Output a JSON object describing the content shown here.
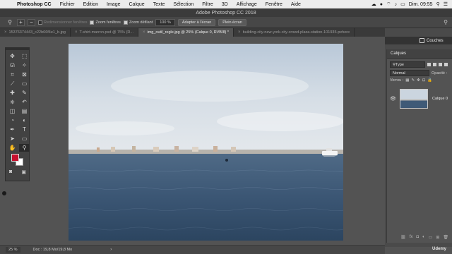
{
  "menubar": {
    "app_name": "Photoshop CC",
    "items": [
      "Fichier",
      "Edition",
      "Image",
      "Calque",
      "Texte",
      "Sélection",
      "Filtre",
      "3D",
      "Affichage",
      "Fenêtre",
      "Aide"
    ],
    "clock": "Dim. 09:55"
  },
  "titlebar": {
    "title": "Adobe Photoshop CC 2018"
  },
  "optionsbar": {
    "redimensionner_label": "Redimensionner fenêtres",
    "zoom_fenetres_label": "Zoom fenêtres",
    "zoom_defilant_label": "Zoom défilant",
    "zoom_value": "100 %",
    "fit_button": "Adapter à l'écran",
    "fill_button": "Plein écran"
  },
  "tabs": [
    {
      "label": "15376374443_c22b66f4e1_b.jpg",
      "active": false
    },
    {
      "label": "T-shirt-marron.psd @ 75% (R...",
      "active": false
    },
    {
      "label": "img_outil_regle.jpg @ 25% (Calque 0, RVB/8) *",
      "active": true
    },
    {
      "label": "building-city-new-york-city-crowd-plaza-station-101935-pxhere",
      "active": false
    }
  ],
  "tools": {
    "icons": [
      "move-icon",
      "marquee-icon",
      "lasso-icon",
      "magic-wand-icon",
      "crop-icon",
      "frame-icon",
      "eyedropper-icon",
      "ruler-icon",
      "healing-icon",
      "brush-icon",
      "stamp-icon",
      "history-brush-icon",
      "eraser-icon",
      "gradient-icon",
      "blur-icon",
      "dodge-icon",
      "pen-icon",
      "type-icon",
      "path-select-icon",
      "shape-icon",
      "hand-icon",
      "zoom-icon"
    ],
    "glyphs": [
      "✥",
      "⬚",
      "ᘏ",
      "✧",
      "⌗",
      "⊠",
      "⟋",
      "▭",
      "✚",
      "✎",
      "⎈",
      "↶",
      "◫",
      "▤",
      "◔",
      "◐",
      "✒",
      "T",
      "➤",
      "▭",
      "✋",
      "⚲"
    ],
    "foreground_color": "#c8102e",
    "background_color": "#ffffff"
  },
  "layers_panel": {
    "couches_label": "Couches",
    "title": "Calques",
    "filter_type": "Type",
    "blend_mode": "Normal",
    "opacity_label": "Opacité :",
    "lock_label": "Verrou :",
    "layer_name": "Calque 0"
  },
  "statusbar": {
    "zoom": "25 %",
    "doc_info": "Doc : 19,8 Mo/19,8 Mo"
  },
  "watermark": "Udemy"
}
